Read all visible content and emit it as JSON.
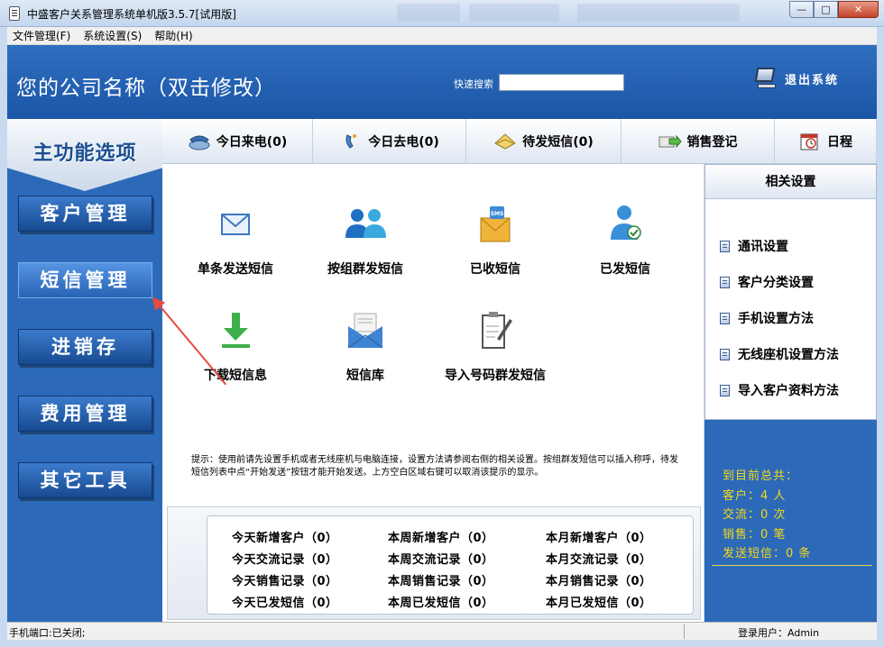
{
  "window": {
    "title": "中盛客户关系管理系统单机版3.5.7[试用版]",
    "controls": {
      "minimize": "—",
      "maximize": "□",
      "close": "✕"
    }
  },
  "menu": [
    "文件管理(F)",
    "系统设置(S)",
    "帮助(H)"
  ],
  "header": {
    "company": "您的公司名称（双击修改）",
    "search_label": "快速搜索",
    "search_value": "",
    "exit_label": "退出系统"
  },
  "sidebar": {
    "title": "主功能选项",
    "items": [
      "客户管理",
      "短信管理",
      "进销存",
      "费用管理",
      "其它工具"
    ],
    "active": "短信管理"
  },
  "tabs": [
    "今日来电(0)",
    "今日去电(0)",
    "待发短信(0)",
    "销售登记",
    "日程"
  ],
  "main": {
    "items": [
      "单条发送短信",
      "按组群发短信",
      "已收短信",
      "已发短信",
      "下载短信息",
      "短信库",
      "导入号码群发短信"
    ],
    "tip": "提示：使用前请先设置手机或者无线座机与电脑连接，设置方法请参阅右侧的相关设置。按组群发短信可以插入称呼，待发短信列表中点“开始发送”按钮才能开始发送。上方空白区域右键可以取消该提示的显示。",
    "stats": [
      [
        "今天新增客户（0）",
        "本周新增客户（0）",
        "本月新增客户（0）"
      ],
      [
        "今天交流记录（0）",
        "本周交流记录（0）",
        "本月交流记录（0）"
      ],
      [
        "今天销售记录（0）",
        "本周销售记录（0）",
        "本月销售记录（0）"
      ],
      [
        "今天已发短信（0）",
        "本周已发短信（0）",
        "本月已发短信（0）"
      ]
    ]
  },
  "settings": {
    "title": "相关设置",
    "links": [
      "通讯设置",
      "客户分类设置",
      "手机设置方法",
      "无线座机设置方法",
      "导入客户资料方法"
    ]
  },
  "summary": {
    "title": "到目前总共：",
    "lines": [
      "客户：4 人",
      "交流：0 次",
      "销售：0 笔",
      "发送短信：0 条"
    ]
  },
  "status": {
    "left": "手机端口:已关闭;",
    "right": "登录用户：Admin"
  },
  "colors": {
    "primary_blue": "#2c6ab9",
    "summary_text": "#f5d81a",
    "annotation_arrow": "#e84b3c"
  }
}
